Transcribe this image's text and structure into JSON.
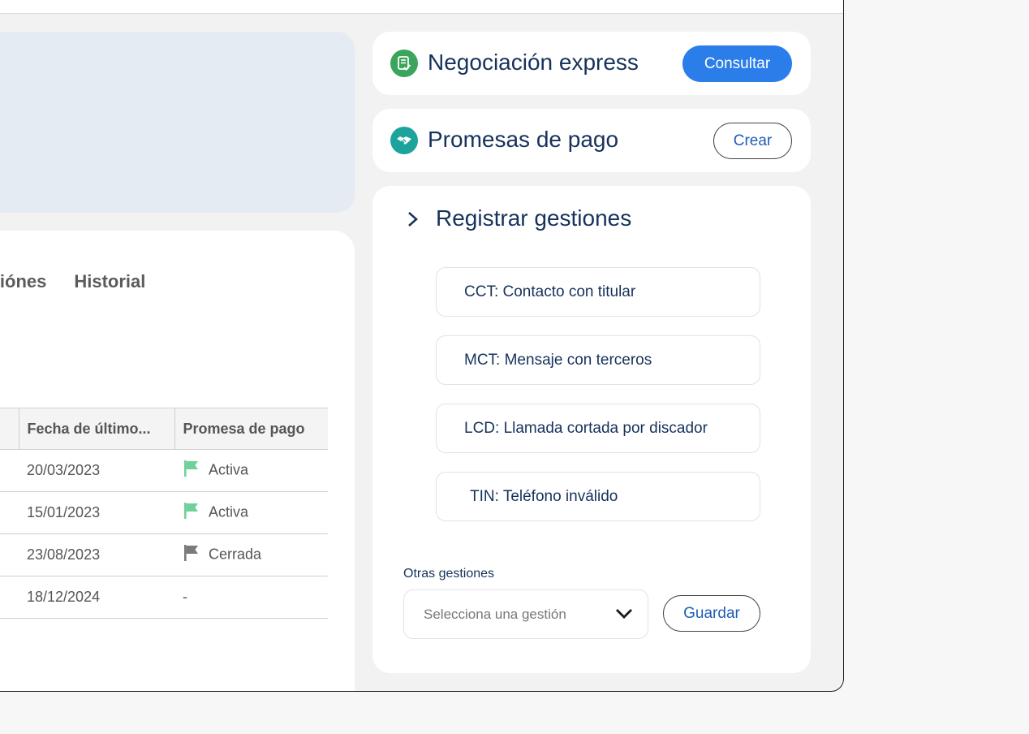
{
  "tabs": [
    {
      "label": "Gestiónes"
    },
    {
      "label": "Historial"
    }
  ],
  "table": {
    "headers": [
      "Fecha de último...",
      "Promesa de pago"
    ],
    "rows": [
      {
        "fecha": "20/03/2023",
        "promesa": "Activa",
        "flag": "flag-green"
      },
      {
        "fecha": "15/01/2023",
        "promesa": "Activa",
        "flag": "flag-green"
      },
      {
        "fecha": "23/08/2023",
        "promesa": "Cerrada",
        "flag": "flag-gray"
      },
      {
        "fecha": "18/12/2024",
        "promesa": "-",
        "flag": ""
      }
    ]
  },
  "negociacion": {
    "title": "Negociación express",
    "button": "Consultar",
    "icon": "document-check-icon"
  },
  "promesas": {
    "title": "Promesas de pago",
    "button": "Crear",
    "icon": "handshake-icon"
  },
  "registrar": {
    "title": "Registrar gestiones",
    "options": [
      {
        "label": "CCT: Contacto con titular"
      },
      {
        "label": "MCT: Mensaje con terceros"
      },
      {
        "label": "LCD: Llamada cortada por discador"
      },
      {
        "label": "TIN: Teléfono inválido"
      }
    ],
    "otras_label": "Otras gestiones",
    "select_placeholder": "Selecciona una gestión",
    "save_button": "Guardar"
  },
  "colors": {
    "accent": "#2b7de9",
    "icon_green": "#3ba55c",
    "icon_teal": "#1ba39c",
    "flag_green": "#6fd29a",
    "flag_gray": "#7a7a7a"
  }
}
